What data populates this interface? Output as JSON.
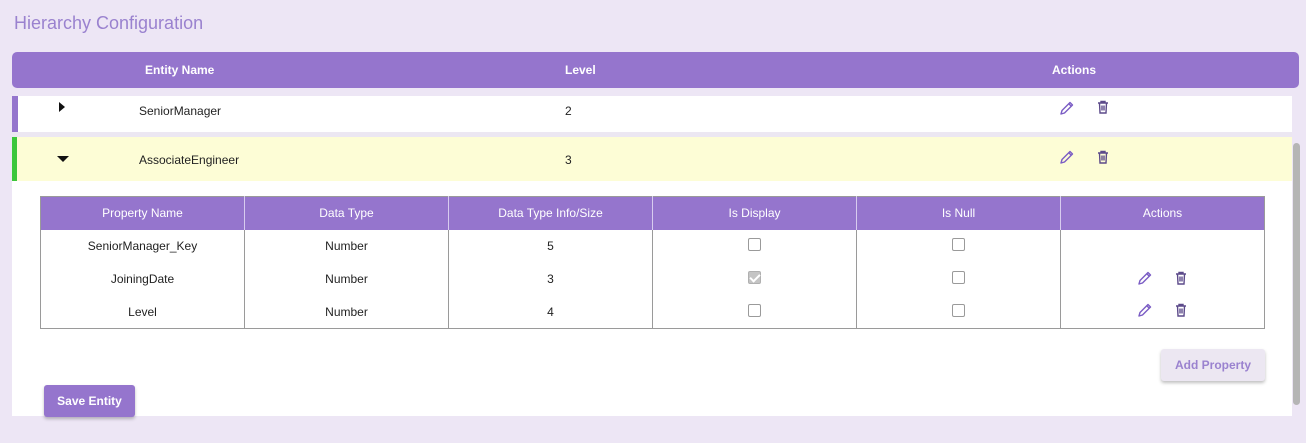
{
  "page": {
    "title": "Hierarchy Configuration"
  },
  "header": {
    "entity_name": "Entity Name",
    "level": "Level",
    "actions": "Actions"
  },
  "entities": [
    {
      "name": "SeniorManager",
      "level": "2",
      "expanded": false
    },
    {
      "name": "AssociateEngineer",
      "level": "3",
      "expanded": true
    }
  ],
  "properties": {
    "columns": [
      "Property Name",
      "Data Type",
      "Data Type Info/Size",
      "Is Display",
      "Is Null",
      "Actions"
    ],
    "rows": [
      {
        "name": "SeniorManager_Key",
        "type": "Number",
        "size": "5",
        "is_display": false,
        "is_null": false,
        "has_actions": false
      },
      {
        "name": "JoiningDate",
        "type": "Number",
        "size": "3",
        "is_display": true,
        "is_null": false,
        "has_actions": true
      },
      {
        "name": "Level",
        "type": "Number",
        "size": "4",
        "is_display": false,
        "is_null": false,
        "has_actions": true
      }
    ]
  },
  "buttons": {
    "add_property": "Add Property",
    "save_entity": "Save Entity"
  },
  "icons": {
    "edit": "pencil-icon",
    "delete": "trash-icon",
    "collapsed": "caret-right-icon",
    "expanded": "caret-down-icon"
  },
  "colors": {
    "accent": "#9575cd",
    "background": "#ede6f5",
    "expanded_row": "#fdfdd6",
    "expanded_marker": "#3cc63c"
  }
}
